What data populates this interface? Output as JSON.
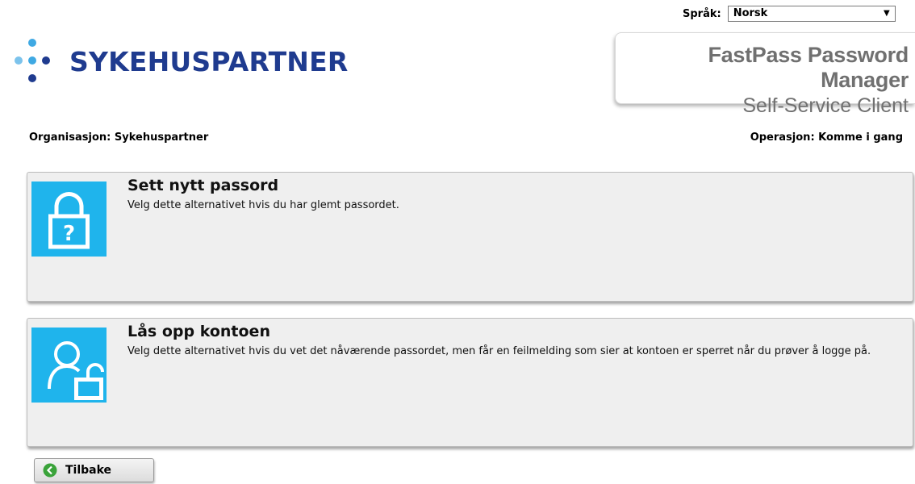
{
  "language": {
    "label": "Språk:",
    "selected": "Norsk"
  },
  "brand": {
    "logo_text": "SYKEHUSPARTNER",
    "dot_color": "#1f3b8f",
    "dot_color_light": "#3fa9e3"
  },
  "product": {
    "name": "FastPass Password Manager",
    "subtitle": "Self-Service Client"
  },
  "info": {
    "organization": "Organisasjon: Sykehuspartner",
    "operation": "Operasjon: Komme i gang"
  },
  "options": [
    {
      "title": "Sett nytt passord",
      "description": "Velg dette alternativet hvis du har glemt passordet.",
      "icon": "padlock-question-icon"
    },
    {
      "title": "Lås opp kontoen",
      "description": "Velg dette alternativet hvis du vet det nåværende passordet, men får en feilmelding som sier at kontoen er sperret når du prøver å logge på.",
      "icon": "user-unlock-icon"
    }
  ],
  "back_button": {
    "label": "Tilbake",
    "icon": "arrow-left-circle-icon"
  },
  "colors": {
    "icon_bg": "#1fb4ec",
    "card_bg": "#efefef",
    "back_icon": "#3aa33a"
  }
}
